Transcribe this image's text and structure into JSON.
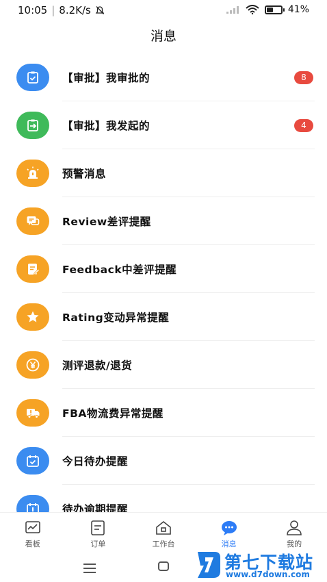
{
  "status_bar": {
    "time": "10:05",
    "net_speed": "8.2K/s",
    "battery": "41%"
  },
  "header": {
    "title": "消息"
  },
  "colors": {
    "blue": "#3b8cf0",
    "green": "#3fba5a",
    "orange": "#f6a325",
    "badge": "#e84a3f",
    "active_tab": "#2d7cf6"
  },
  "messages": [
    {
      "label": "【审批】我审批的",
      "icon": "approval-clipboard-icon",
      "badge": "8"
    },
    {
      "label": "【审批】我发起的",
      "icon": "initiated-approval-icon",
      "badge": "4"
    },
    {
      "label": "预警消息",
      "icon": "alarm-light-icon"
    },
    {
      "label": "Review差评提醒",
      "icon": "review-chat-icon"
    },
    {
      "label": "Feedback中差评提醒",
      "icon": "feedback-note-icon"
    },
    {
      "label": "Rating变动异常提醒",
      "icon": "rating-star-icon"
    },
    {
      "label": "测评退款/退货",
      "icon": "refund-yen-icon"
    },
    {
      "label": "FBA物流费异常提醒",
      "icon": "fba-truck-icon"
    },
    {
      "label": "今日待办提醒",
      "icon": "todo-calendar-icon"
    },
    {
      "label": "待办逾期提醒",
      "icon": "overdue-calendar-icon"
    }
  ],
  "tabbar": [
    {
      "label": "看板",
      "icon": "dashboard-chart-icon"
    },
    {
      "label": "订单",
      "icon": "orders-list-icon"
    },
    {
      "label": "工作台",
      "icon": "workbench-home-icon"
    },
    {
      "label": "消息",
      "icon": "message-bubble-icon",
      "active": true
    },
    {
      "label": "我的",
      "icon": "profile-person-icon"
    }
  ],
  "watermark": {
    "title": "第七下载站",
    "url": "www.d7down.com"
  }
}
